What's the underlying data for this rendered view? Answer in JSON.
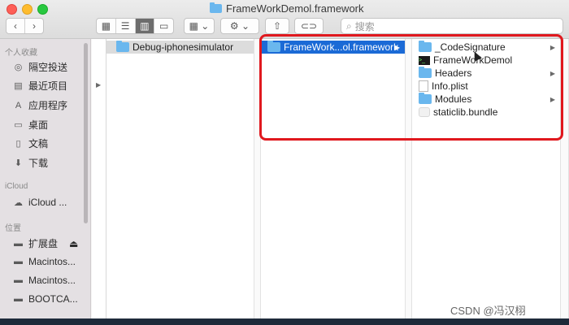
{
  "window": {
    "title": "FrameWorkDemol.framework"
  },
  "toolbar": {
    "back": "‹",
    "forward": "›",
    "view_icons": "▦",
    "view_list": "☰",
    "view_columns": "▥",
    "view_gallery": "▭",
    "group_label": "▦ ⌄",
    "action_label": "⚙ ⌄",
    "share_label": "⇧",
    "tag_label": "⊂⊃",
    "search_placeholder": "搜索"
  },
  "sidebar": {
    "favorites_header": "个人收藏",
    "favorites": [
      {
        "label": "隔空投送",
        "icon": "airdrop-icon"
      },
      {
        "label": "最近项目",
        "icon": "recents-icon"
      },
      {
        "label": "应用程序",
        "icon": "applications-icon"
      },
      {
        "label": "桌面",
        "icon": "desktop-icon"
      },
      {
        "label": "文稿",
        "icon": "documents-icon"
      },
      {
        "label": "下载",
        "icon": "downloads-icon"
      }
    ],
    "icloud_header": "iCloud",
    "icloud_items": [
      {
        "label": "iCloud ...",
        "icon": "cloud-icon"
      }
    ],
    "locations_header": "位置",
    "locations": [
      {
        "label": "扩展盘",
        "eject": "⏏"
      },
      {
        "label": "Macintos..."
      },
      {
        "label": "Macintos..."
      },
      {
        "label": "BOOTCA..."
      }
    ]
  },
  "columns": {
    "col1": {
      "items": [
        {
          "label": "Debug-iphonesimulator",
          "arrow": "▶"
        }
      ]
    },
    "col2": {
      "items": [
        {
          "label": "FrameWork...ol.framework",
          "arrow": "▶"
        }
      ]
    },
    "col3": {
      "items": [
        {
          "label": "_CodeSignature",
          "type": "folder",
          "arrow": "▶"
        },
        {
          "label": "FrameWorkDemol",
          "type": "exec"
        },
        {
          "label": "Headers",
          "type": "folder",
          "arrow": "▶"
        },
        {
          "label": "Info.plist",
          "type": "doc"
        },
        {
          "label": "Modules",
          "type": "folder",
          "arrow": "▶"
        },
        {
          "label": "staticlib.bundle",
          "type": "bundle"
        }
      ]
    }
  },
  "watermark": "CSDN @冯汉栩",
  "colors": {
    "selection": "#1b6ad6",
    "highlight_box": "#e0181e",
    "folder": "#6ab7ee"
  }
}
